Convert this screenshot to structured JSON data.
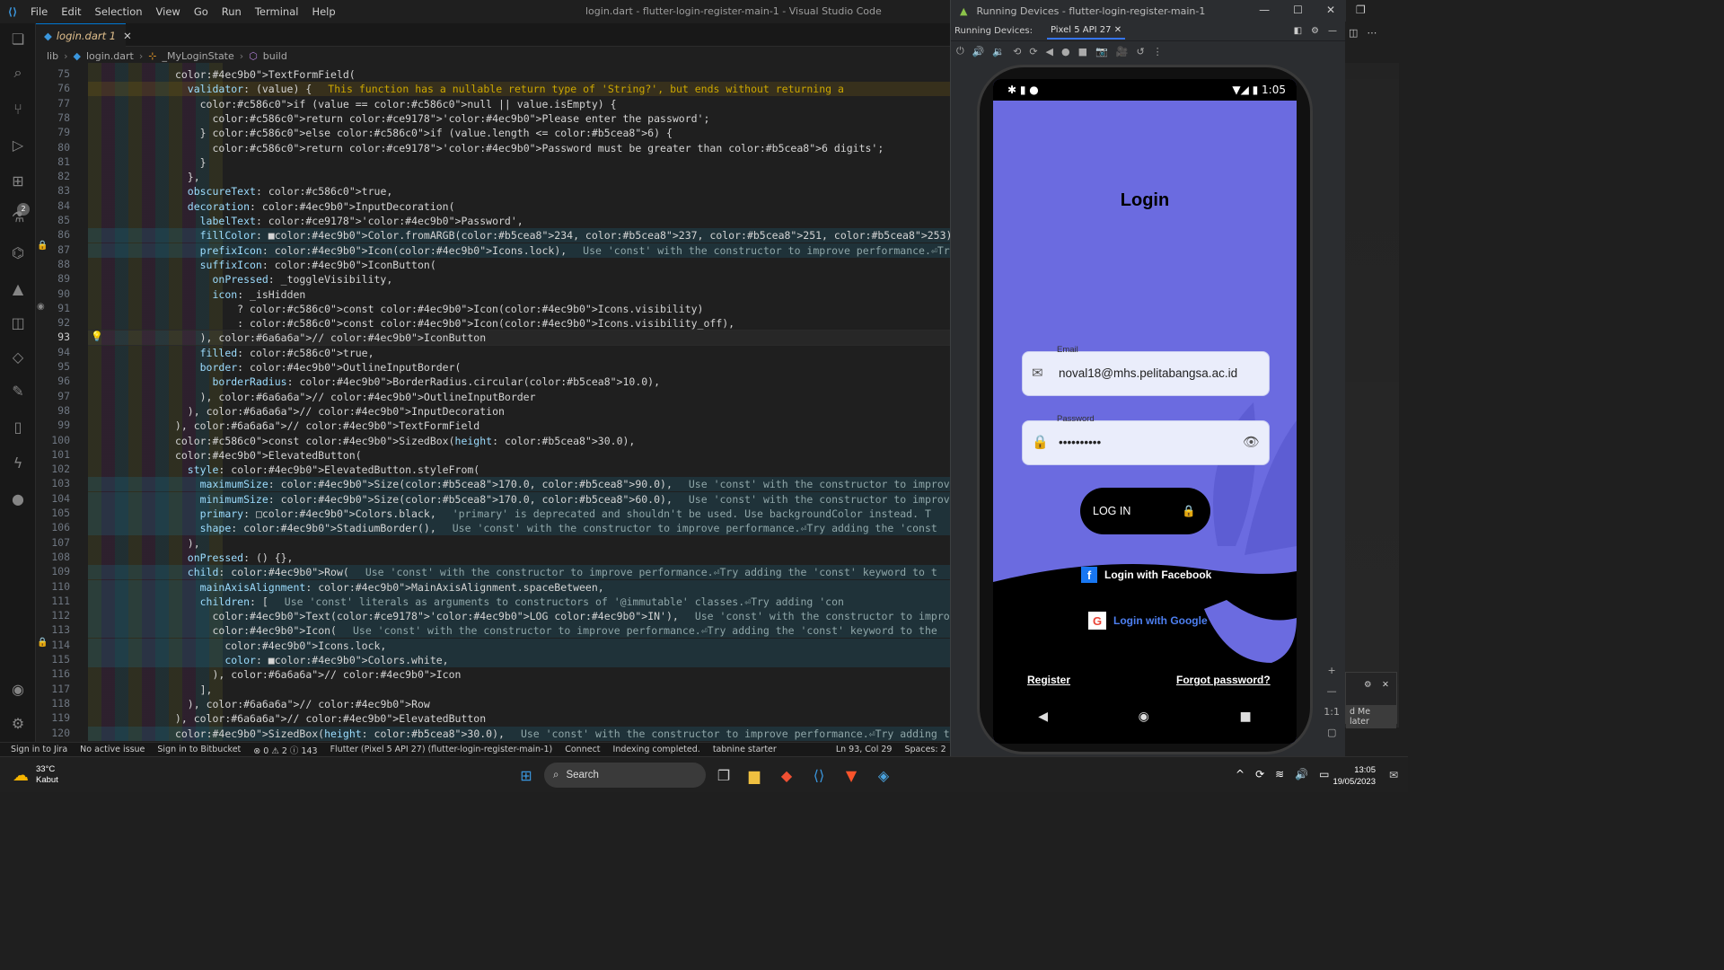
{
  "menu": [
    "File",
    "Edit",
    "Selection",
    "View",
    "Go",
    "Run",
    "Terminal",
    "Help"
  ],
  "window_title": "login.dart - flutter-login-register-main-1 - Visual Studio Code",
  "tab": {
    "label": "login.dart",
    "modified": "1"
  },
  "breadcrumb": {
    "root": "lib",
    "file": "login.dart",
    "cls": "_MyLoginState",
    "method": "build"
  },
  "activity_badge": "2",
  "code": [
    {
      "n": "75",
      "t": "              TextFormField(",
      "k": ""
    },
    {
      "n": "76",
      "t": "                validator: (value) {",
      "k": "warn",
      "h": "This function has a nullable return type of 'String?', but ends without returning a",
      "hw": true
    },
    {
      "n": "77",
      "t": "                  if (value == null || value.isEmpty) {",
      "k": ""
    },
    {
      "n": "78",
      "t": "                    return 'Please enter the password';",
      "k": ""
    },
    {
      "n": "79",
      "t": "                  } else if (value.length <= 6) {",
      "k": ""
    },
    {
      "n": "80",
      "t": "                    return 'Password must be greater than 6 digits';",
      "k": ""
    },
    {
      "n": "81",
      "t": "                  }",
      "k": ""
    },
    {
      "n": "82",
      "t": "                },",
      "k": ""
    },
    {
      "n": "83",
      "t": "                obscureText: true,",
      "k": ""
    },
    {
      "n": "84",
      "t": "                decoration: InputDecoration(",
      "k": ""
    },
    {
      "n": "85",
      "t": "                  labelText: 'Password',",
      "k": ""
    },
    {
      "n": "86",
      "t": "                  fillColor: ■Color.fromARGB(234, 237, 251, 253),",
      "k": "info",
      "h": "Use 'const' with the constructor to improve performan"
    },
    {
      "n": "87",
      "t": "                  prefixIcon: Icon(Icons.lock),",
      "k": "info",
      "h": "Use 'const' with the constructor to improve performance.⏎Try adding the"
    },
    {
      "n": "88",
      "t": "                  suffixIcon: IconButton(",
      "k": ""
    },
    {
      "n": "89",
      "t": "                    onPressed: _toggleVisibility,",
      "k": ""
    },
    {
      "n": "90",
      "t": "                    icon: _isHidden",
      "k": ""
    },
    {
      "n": "91",
      "t": "                        ? const Icon(Icons.visibility)",
      "k": ""
    },
    {
      "n": "92",
      "t": "                        : const Icon(Icons.visibility_off),",
      "k": ""
    },
    {
      "n": "93",
      "t": "                  ), // IconButton",
      "k": "cur"
    },
    {
      "n": "94",
      "t": "                  filled: true,",
      "k": ""
    },
    {
      "n": "95",
      "t": "                  border: OutlineInputBorder(",
      "k": ""
    },
    {
      "n": "96",
      "t": "                    borderRadius: BorderRadius.circular(10.0),",
      "k": ""
    },
    {
      "n": "97",
      "t": "                  ), // OutlineInputBorder",
      "k": ""
    },
    {
      "n": "98",
      "t": "                ), // InputDecoration",
      "k": ""
    },
    {
      "n": "99",
      "t": "              ), // TextFormField",
      "k": ""
    },
    {
      "n": "100",
      "t": "              const SizedBox(height: 30.0),",
      "k": ""
    },
    {
      "n": "101",
      "t": "              ElevatedButton(",
      "k": ""
    },
    {
      "n": "102",
      "t": "                style: ElevatedButton.styleFrom(",
      "k": ""
    },
    {
      "n": "103",
      "t": "                  maximumSize: Size(170.0, 90.0),",
      "k": "info",
      "h": "Use 'const' with the constructor to improve performance.⏎Try adding th"
    },
    {
      "n": "104",
      "t": "                  minimumSize: Size(170.0, 60.0),",
      "k": "info",
      "h": "Use 'const' with the constructor to improve performance.⏎Try adding th"
    },
    {
      "n": "105",
      "t": "                  primary: □Colors.black,",
      "k": "info",
      "h": "'primary' is deprecated and shouldn't be used. Use backgroundColor instead. T"
    },
    {
      "n": "106",
      "t": "                  shape: StadiumBorder(),",
      "k": "info",
      "h": "Use 'const' with the constructor to improve performance.⏎Try adding the 'const"
    },
    {
      "n": "107",
      "t": "                ),",
      "k": ""
    },
    {
      "n": "108",
      "t": "                onPressed: () {},",
      "k": ""
    },
    {
      "n": "109",
      "t": "                child: Row(",
      "k": "info",
      "h": "Use 'const' with the constructor to improve performance.⏎Try adding the 'const' keyword to t"
    },
    {
      "n": "110",
      "t": "                  mainAxisAlignment: MainAxisAlignment.spaceBetween,",
      "k": "info"
    },
    {
      "n": "111",
      "t": "                  children: [",
      "k": "info",
      "h": "Use 'const' literals as arguments to constructors of '@immutable' classes.⏎Try adding 'con"
    },
    {
      "n": "112",
      "t": "                    Text('LOG IN'),",
      "k": "info",
      "h": "Use 'const' with the constructor to improve performance.⏎Try adding the 'const' keyw"
    },
    {
      "n": "113",
      "t": "                    Icon(",
      "k": "info",
      "h": "Use 'const' with the constructor to improve performance.⏎Try adding the 'const' keyword to the"
    },
    {
      "n": "114",
      "t": "                      Icons.lock,",
      "k": "info"
    },
    {
      "n": "115",
      "t": "                      color: ■Colors.white,",
      "k": "info"
    },
    {
      "n": "116",
      "t": "                    ), // Icon",
      "k": ""
    },
    {
      "n": "117",
      "t": "                  ],",
      "k": ""
    },
    {
      "n": "118",
      "t": "                ), // Row",
      "k": ""
    },
    {
      "n": "119",
      "t": "              ), // ElevatedButton",
      "k": ""
    },
    {
      "n": "120",
      "t": "              SizedBox(height: 30.0),",
      "k": "info",
      "h": "Use 'const' with the constructor to improve performance.⏎Try adding the 'const' ke"
    }
  ],
  "statusbar": {
    "jira": "Sign in to Jira",
    "issue": "No active issue",
    "bitbucket": "Sign in to Bitbucket",
    "problems": "⊗ 0 ⚠ 2 ⓘ 143",
    "flutter": "Flutter (Pixel 5 API 27) (flutter-login-register-main-1)",
    "connect": "Connect",
    "indexing": "Indexing completed.",
    "tabnine": "tabnine starter",
    "position": "Ln 93, Col 29",
    "spaces": "Spaces: 2"
  },
  "emulator": {
    "title": "Running Devices - flutter-login-register-main-1",
    "running_label": "Running Devices:",
    "device_tab": "Pixel 5 API 27",
    "time": "1:05",
    "zoom_label": "1:1"
  },
  "app": {
    "title": "Login",
    "email_label": "Email",
    "email_value": "noval18@mhs.pelitabangsa.ac.id",
    "password_label": "Password",
    "password_value": "••••••••••",
    "login_button": "LOG IN",
    "facebook": "Login with Facebook",
    "google": "Login with Google",
    "register": "Register",
    "forgot": "Forgot password?",
    "colors": {
      "bg": "#6b6be0",
      "dark": "#000000",
      "field": "#eaedfb"
    }
  },
  "popup": {
    "text": "d Me later"
  },
  "taskbar": {
    "temp": "33°C",
    "weather": "Kabut",
    "search": "Search",
    "time": "13:05",
    "date": "19/05/2023"
  }
}
